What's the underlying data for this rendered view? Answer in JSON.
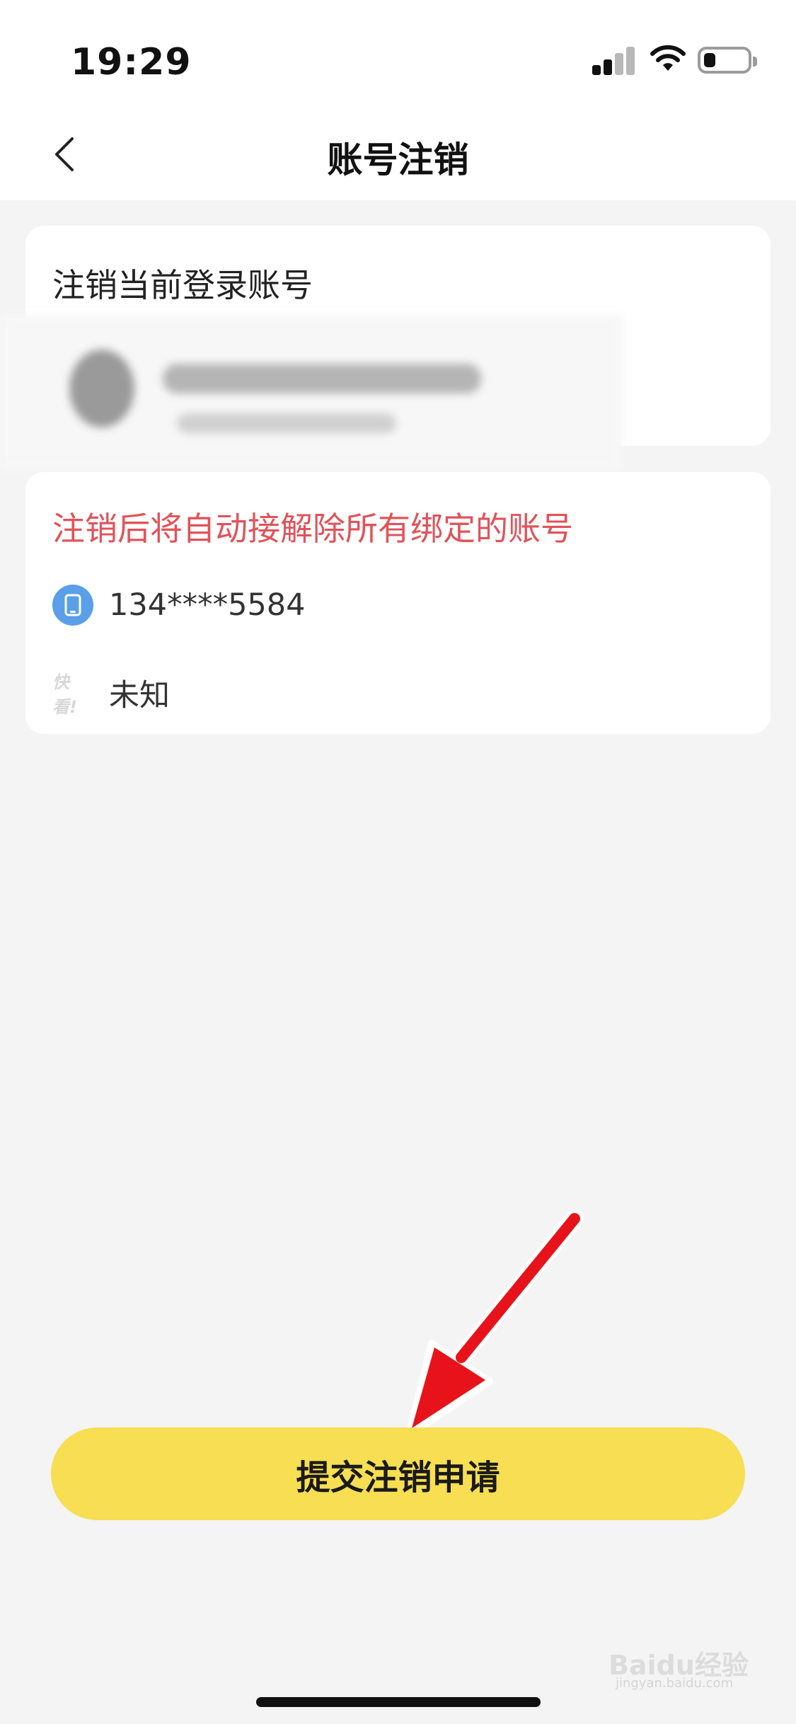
{
  "status_bar": {
    "time": "19:29"
  },
  "nav": {
    "title": "账号注销"
  },
  "account_card": {
    "heading": "注销当前登录账号"
  },
  "bound_card": {
    "warning": "注销后将自动接解除所有绑定的账号",
    "items": [
      {
        "icon": "phone-icon",
        "value": "134****5584"
      },
      {
        "icon": "kuaikan-logo-icon",
        "label": "快看!",
        "value": "未知"
      }
    ]
  },
  "submit_button": {
    "label": "提交注销申请"
  },
  "watermark": {
    "text": "Baidu经验",
    "url": "jingyan.baidu.com"
  },
  "colors": {
    "accent": "#f7de52",
    "warning": "#e0535a",
    "phone_icon": "#5a9fe8",
    "annotation_arrow": "#e8131a"
  }
}
